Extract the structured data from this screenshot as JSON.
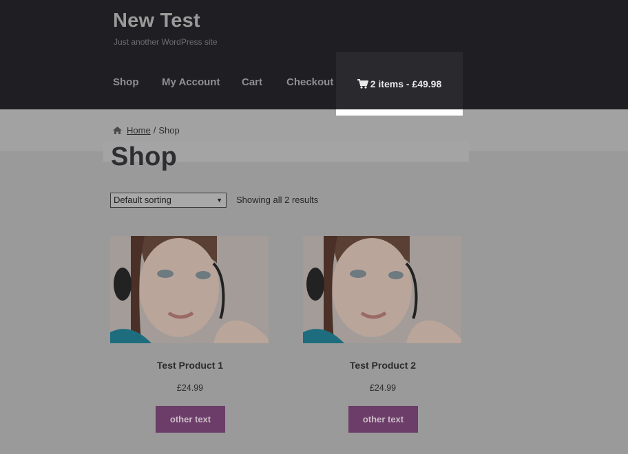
{
  "site": {
    "title": "New Test",
    "tagline": "Just another WordPress site"
  },
  "nav": {
    "items": [
      {
        "label": "Shop"
      },
      {
        "label": "My Account"
      },
      {
        "label": "Cart"
      },
      {
        "label": "Checkout"
      }
    ],
    "cart": {
      "icon": "shopping-cart-icon",
      "label": "2 items - £49.98"
    }
  },
  "breadcrumb": {
    "icon": "home-icon",
    "home": "Home",
    "separator": "/",
    "current": "Shop"
  },
  "page": {
    "title": "Shop"
  },
  "sorting": {
    "selected": "Default sorting"
  },
  "results": {
    "text": "Showing all 2 results"
  },
  "products": [
    {
      "name": "Test Product 1",
      "price": "£24.99",
      "button": "other text"
    },
    {
      "name": "Test Product 2",
      "price": "£24.99",
      "button": "other text"
    }
  ],
  "colors": {
    "header_bg": "#1f1f23",
    "button_bg": "#6b3d68",
    "page_overlay": "#9a9a9a"
  }
}
